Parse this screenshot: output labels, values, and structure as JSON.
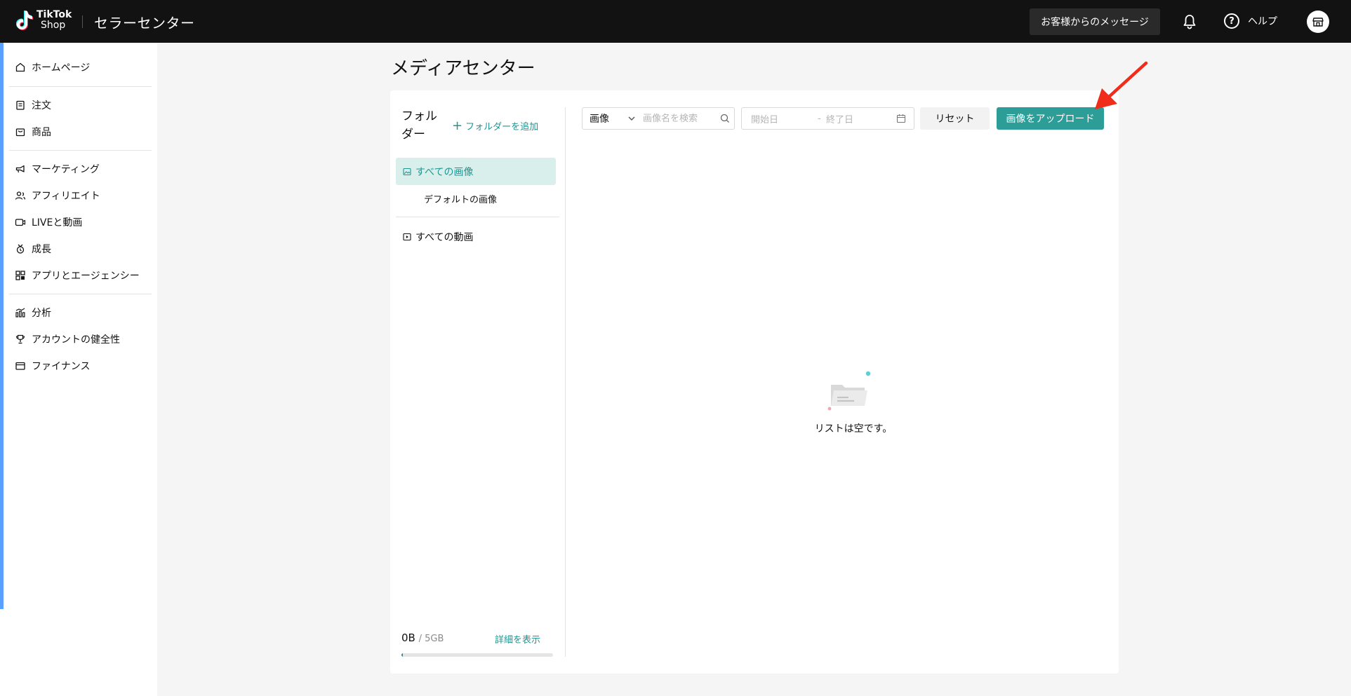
{
  "topbar": {
    "logo_line1": "TikTok",
    "logo_line2": "Shop",
    "app_title": "セラーセンター",
    "messages_label": "お客様からのメッセージ",
    "help_label": "ヘルプ"
  },
  "sidebar": {
    "items": [
      {
        "label": "ホームページ",
        "icon": "home-icon"
      },
      {
        "label": "注文",
        "icon": "clipboard-icon"
      },
      {
        "label": "商品",
        "icon": "bag-icon"
      },
      {
        "label": "マーケティング",
        "icon": "megaphone-icon"
      },
      {
        "label": "アフィリエイト",
        "icon": "people-icon"
      },
      {
        "label": "LIVEと動画",
        "icon": "video-icon"
      },
      {
        "label": "成長",
        "icon": "growth-icon"
      },
      {
        "label": "アプリとエージェンシー",
        "icon": "apps-icon"
      },
      {
        "label": "分析",
        "icon": "chart-icon"
      },
      {
        "label": "アカウントの健全性",
        "icon": "trophy-icon"
      },
      {
        "label": "ファイナンス",
        "icon": "wallet-icon"
      }
    ]
  },
  "main": {
    "page_title": "メディアセンター",
    "folders": {
      "title": "フォルダー",
      "add_folder_label": "フォルダーを追加",
      "all_images": "すべての画像",
      "default_images": "デフォルトの画像",
      "all_videos": "すべての動画"
    },
    "storage": {
      "used": "0B",
      "total": "/ 5GB",
      "details_label": "詳細を表示",
      "used_fraction": 0.01
    },
    "toolbar": {
      "media_type_value": "画像",
      "search_placeholder": "画像名を検索",
      "start_date_placeholder": "開始日",
      "date_separator": "-",
      "end_date_placeholder": "終了日",
      "reset_label": "リセット",
      "upload_label": "画像をアップロード"
    },
    "empty_text": "リストは空です。"
  },
  "colors": {
    "accent": "#2d9d97",
    "topbar": "#121212",
    "arrow": "#f02d1a"
  }
}
